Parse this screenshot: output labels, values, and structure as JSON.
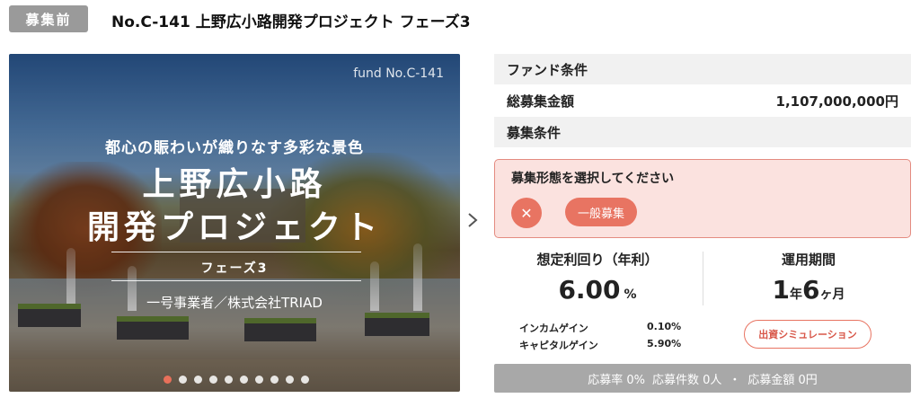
{
  "header": {
    "status_badge": "募集前",
    "title": "No.C-141 上野広小路開発プロジェクト フェーズ3"
  },
  "hero": {
    "fund_label": "fund No.C-141",
    "catchphrase": "都心の賑わいが織りなす多彩な景色",
    "title_line1": "上野広小路",
    "title_line2": "開発プロジェクト",
    "phase": "フェーズ3",
    "company": "一号事業者／株式会社TRIAD",
    "slide_count": 10,
    "active_slide": 1
  },
  "conditions": {
    "fund_header": "ファンド条件",
    "total_label": "総募集金額",
    "total_value": "1,107,000,000円",
    "recruit_header": "募集条件"
  },
  "selection": {
    "title": "募集形態を選択してください",
    "close_symbol": "✕",
    "option_label": "一般募集"
  },
  "metrics": {
    "yield_label": "想定利回り（年利）",
    "yield_value": "6.00",
    "yield_unit": "%",
    "period_label": "運用期間",
    "period_years": "1",
    "period_year_unit": "年",
    "period_months": "6",
    "period_month_unit": "ヶ月",
    "income_label": "インカムゲイン",
    "income_value": "0.10%",
    "capital_label": "キャピタルゲイン",
    "capital_value": "5.90%",
    "simulation_label": "出資シミュレーション"
  },
  "stats": {
    "rate": "応募率 0%",
    "count": "応募件数 0人",
    "separator": "・",
    "amount": "応募金額 0円"
  },
  "colors": {
    "accent": "#e87462",
    "badge_grey": "#9a9a9a",
    "select_bg": "#fbe2df",
    "stats_bar": "#a8a8a8"
  }
}
